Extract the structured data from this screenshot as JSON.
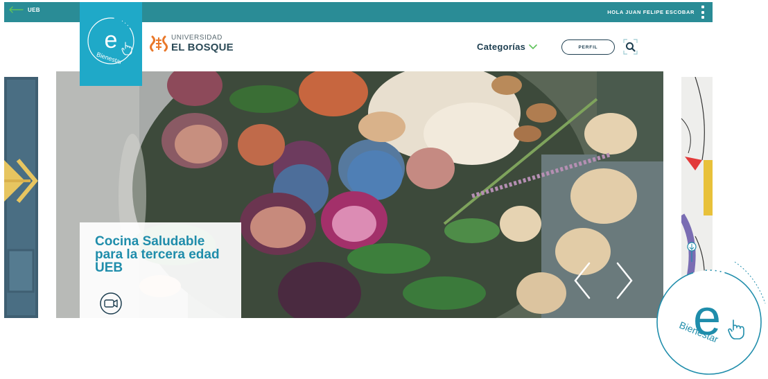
{
  "topbar": {
    "back_label": "UEB",
    "greeting": "HOLA JUAN FELIPE ESCOBAR"
  },
  "brand": {
    "logo_letter": "e",
    "logo_word": "Bienestar",
    "university_line1": "UNIVERSIDAD",
    "university_line2": "EL BOSQUE"
  },
  "nav": {
    "categories_label": "Categorías",
    "profile_label": "PERFIL"
  },
  "carousel": {
    "slide_title": "Cocina Saludable para la tercera edad UEB",
    "slide_title_lines": [
      "Cocina Saludable",
      "para la tercera",
      "edad UEB"
    ]
  },
  "float_badge": {
    "letter": "e",
    "word": "Bienestar"
  },
  "colors": {
    "topbar": "#2a8c96",
    "brand_box": "#1fa9c8",
    "accent_green": "#5ec25a",
    "nav_text": "#1c3d4f",
    "caption_title": "#1f8dab",
    "university_orange": "#e9782a"
  },
  "icons": {
    "back": "arrow-left-icon",
    "menu": "kebab-menu-icon",
    "categories": "chevron-down-icon",
    "search": "search-icon",
    "video": "video-camera-icon",
    "prev": "chevron-left-icon",
    "next": "chevron-right-icon",
    "hand": "pointer-hand-icon"
  }
}
